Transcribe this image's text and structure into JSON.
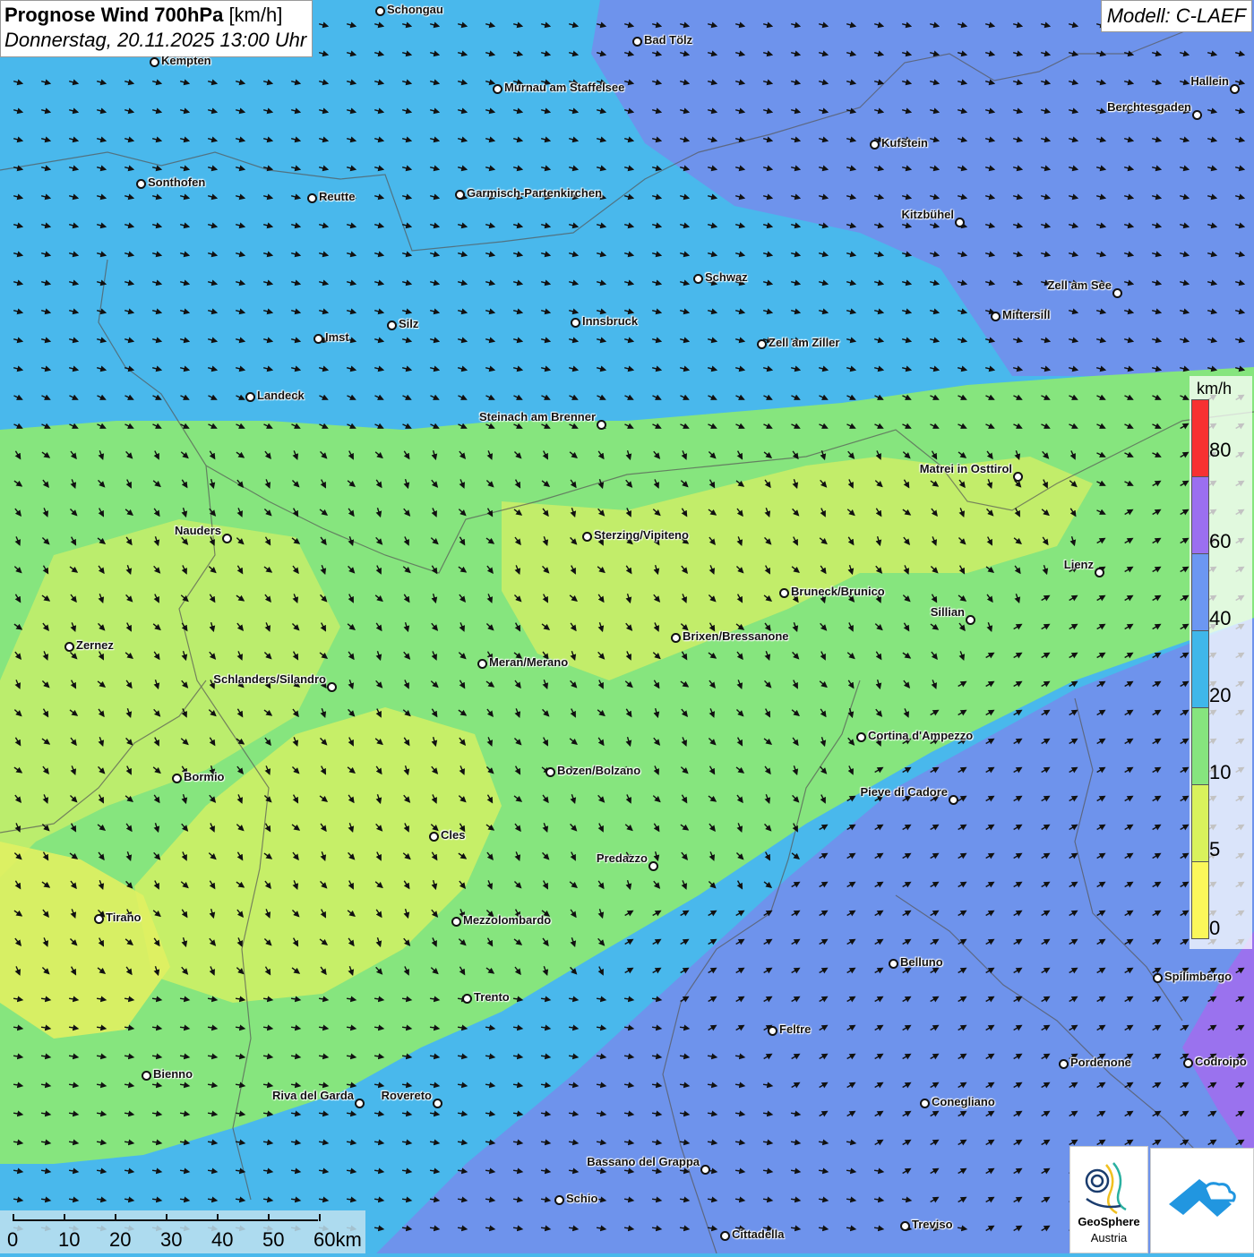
{
  "title": {
    "main": "Prognose Wind 700hPa",
    "unit": "[km/h]",
    "datetime": "Donnerstag, 20.11.2025 13:00 Uhr"
  },
  "model": "Modell: C-LAEF",
  "legend": {
    "unit": "km/h",
    "ticks": [
      "80",
      "60",
      "40",
      "20",
      "10",
      "5",
      "0"
    ],
    "colors": [
      "#f73131",
      "#9b6ff0",
      "#6c97f2",
      "#3fb7ea",
      "#86e57e",
      "#d9f25c",
      "#fbf75a"
    ]
  },
  "scalebar": {
    "labels": [
      "0",
      "10",
      "20",
      "30",
      "40",
      "50",
      "60km"
    ]
  },
  "logos": {
    "geosphere_line1": "GeoSphere",
    "geosphere_line2": "Austria"
  },
  "cities": [
    "Schongau",
    "Bad Tölz",
    "Kempten",
    "Murnau am Staffelsee",
    "Hallein",
    "Berchtesgaden",
    "Kufstein",
    "Sonthofen",
    "Reutte",
    "Garmisch-Partenkirchen",
    "Kitzbühel",
    "Schwaz",
    "Zell am See",
    "Mittersill",
    "Innsbruck",
    "Silz",
    "Imst",
    "Zell am Ziller",
    "Landeck",
    "Steinach am Brenner",
    "Matrei in Osttirol",
    "Nauders",
    "Sterzing/Vipiteno",
    "Lienz",
    "Bruneck/Brunico",
    "Sillian",
    "Brixen/Bressanone",
    "Zernez",
    "Meran/Merano",
    "Schlanders/Silandro",
    "Cortina d'Ampezzo",
    "Bormio",
    "Bozen/Bolzano",
    "Pieve di Cadore",
    "Cles",
    "Predazzo",
    "Tirano",
    "Mezzolombardo",
    "Belluno",
    "Spilimbergo",
    "Trento",
    "Feltre",
    "Pordenone",
    "Codroipo",
    "Bienno",
    "Riva del Garda",
    "Rovereto",
    "Conegliano",
    "Bassano del Grappa",
    "Schio",
    "Treviso",
    "Cittadella"
  ]
}
